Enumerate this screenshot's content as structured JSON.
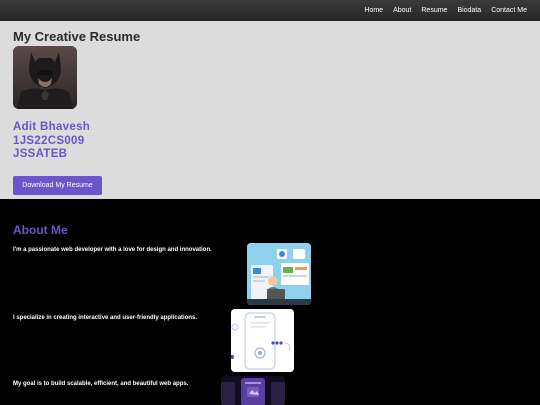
{
  "nav": {
    "items": [
      "Home",
      "About",
      "Resume",
      "Biodata",
      "Contact Me"
    ]
  },
  "hero": {
    "title": "My Creative Resume",
    "name": "Adit Bhavesh",
    "usn": "1JS22CS009",
    "college": "JSSATEB",
    "download_label": "Download My Resume"
  },
  "about": {
    "heading": "About Me",
    "lines": [
      "I'm a passionate web developer with a love for design and innovation.",
      "I specialize in creating interactive and user-friendly applications.",
      "My goal is to build scalable, efficient, and beautiful web apps."
    ]
  },
  "colors": {
    "accent": "#6a55c9",
    "hero_bg": "#dcdcdc",
    "nav_bg": "#2e2e2e"
  }
}
